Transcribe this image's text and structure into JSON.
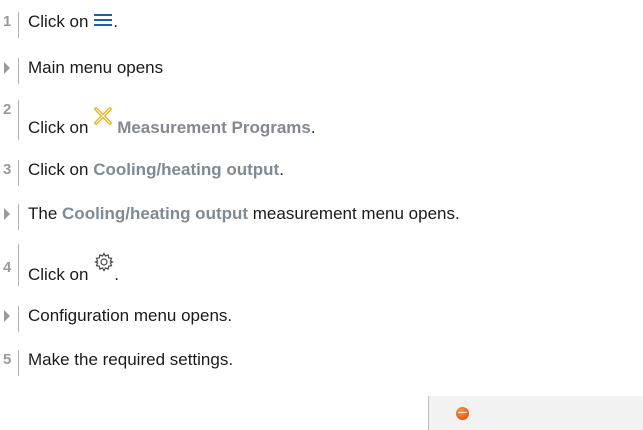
{
  "steps": [
    {
      "marker": "1",
      "text_before": "Click on ",
      "icon": "hamburger-menu-icon",
      "text_after": "."
    },
    {
      "marker": "result",
      "text": "Main menu opens"
    },
    {
      "marker": "2",
      "text_before": "Click on ",
      "icon": "measurement-programs-icon",
      "link": "Measurement Programs",
      "text_after": "."
    },
    {
      "marker": "3",
      "text_before": "Click on ",
      "link": "Cooling/heating output",
      "text_after": "."
    },
    {
      "marker": "result",
      "text_before": "The ",
      "link": "Cooling/heating output",
      "text_after": " measurement menu opens."
    },
    {
      "marker": "4",
      "text_before": "Click on ",
      "icon": "gear-icon",
      "text_after": "."
    },
    {
      "marker": "result",
      "text": "Configuration menu opens."
    },
    {
      "marker": "5",
      "text": "Make the required settings."
    }
  ],
  "colors": {
    "marker": "#9a9a9a",
    "link": "#7f8a93",
    "icon_orange": "#f2a900",
    "hamburger_blue": "#1f5fa8",
    "logo": "#e35a10"
  },
  "device_logo": "testo-logo-icon"
}
